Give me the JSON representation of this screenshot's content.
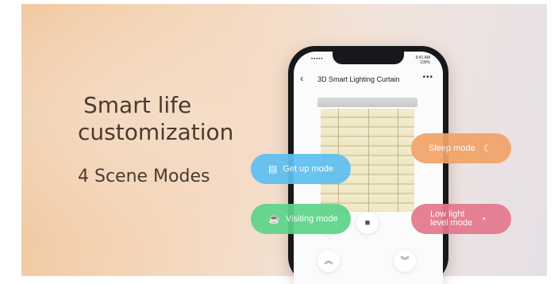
{
  "banner": {
    "headline_line1": "Smart life",
    "headline_line2": "customization",
    "subheadline": "4 Scene Modes"
  },
  "phone": {
    "status_time": "9:41 AM",
    "status_signal": "•••••",
    "status_battery": "100%",
    "back_icon": "chevron-left-icon",
    "title": "3D Smart Lighting Curtain",
    "more_icon": "ellipsis-icon"
  },
  "scenes": {
    "getup": {
      "label": "Get up mode",
      "icon": "calendar-icon",
      "color": "#5ec0f0"
    },
    "sleep": {
      "label": "Sleep mode",
      "icon": "moon-icon",
      "color": "#f2a368"
    },
    "visiting": {
      "label": "Visiting mode",
      "icon": "cup-icon",
      "color": "#5ed48a"
    },
    "low_light": {
      "label_line1": "Low light",
      "label_line2": "level mode",
      "icon": "dim-icon",
      "color": "#e5788d"
    }
  }
}
